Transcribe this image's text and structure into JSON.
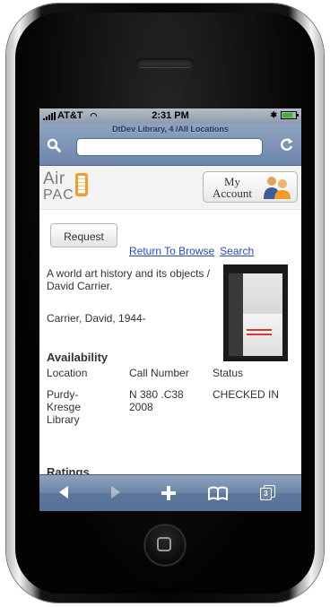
{
  "status_bar": {
    "carrier": "AT&T",
    "time": "2:31 PM"
  },
  "browser": {
    "page_title": "DtDev Library, 4 /All Locations",
    "url_value": ""
  },
  "header": {
    "logo_line1": "Air",
    "logo_line2": "PAC",
    "account_label_line1": "My",
    "account_label_line2": "Account"
  },
  "actions": {
    "request_label": "Request",
    "return_label": "Return To Browse",
    "search_label": "Search"
  },
  "record": {
    "title": "A world art history and its objects / David Carrier.",
    "author": "Carrier, David, 1944-"
  },
  "availability": {
    "heading": "Availability",
    "columns": [
      "Location",
      "Call Number",
      "Status"
    ],
    "rows": [
      {
        "location": "Purdy-Kresge Library",
        "call_number": "N 380 .C38 2008",
        "status": "CHECKED IN"
      }
    ]
  },
  "ratings_heading": "Ratings",
  "toolbar": {
    "icons": [
      "back-icon",
      "forward-icon",
      "add-icon",
      "bookmarks-icon",
      "pages-icon"
    ],
    "pages_count": "3"
  },
  "colors": {
    "link": "#2a48b8",
    "accent_orange": "#f29b2a",
    "toolbar_blue": "#6c84a7"
  }
}
